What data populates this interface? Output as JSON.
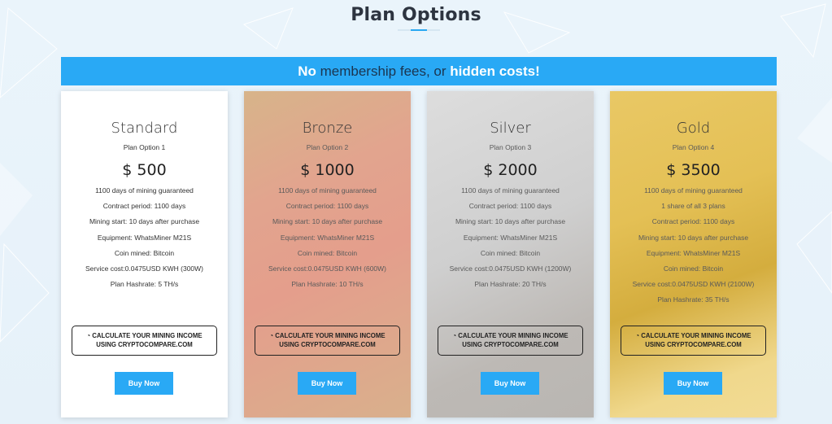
{
  "page": {
    "title": "Plan Options"
  },
  "banner": {
    "part1": "No",
    "part2": " membership fees, or ",
    "part3": "hidden costs!"
  },
  "colors": {
    "accent": "#29a9f5",
    "banner": "#29a9f5",
    "buy_button": "#29a9f5"
  },
  "plans": [
    {
      "name": "Standard",
      "subtitle": "Plan Option 1",
      "price": "$ 500",
      "features": [
        "1100 days of mining guaranteed",
        "Contract period: 1100 days",
        "Mining start: 10 days after purchase",
        "Equipment: WhatsMiner M21S",
        "Coin mined: Bitcoin",
        "Service cost:0.0475USD KWH (300W)",
        "Plan Hashrate: 5 TH/s"
      ],
      "calc_line1": "CALCULATE YOUR MINING INCOME",
      "calc_line2": "USING CRYPTOCOMPARE.COM",
      "buy_label": "Buy Now"
    },
    {
      "name": "Bronze",
      "subtitle": "Plan Option 2",
      "price": "$ 1000",
      "features": [
        "1100 days of mining guaranteed",
        "Contract period: 1100 days",
        "Mining start: 10 days after purchase",
        "Equipment: WhatsMiner M21S",
        "Coin mined: Bitcoin",
        "Service cost:0.0475USD KWH (600W)",
        "Plan Hashrate: 10 TH/s"
      ],
      "calc_line1": "CALCULATE YOUR MINING INCOME",
      "calc_line2": "USING CRYPTOCOMPARE.COM",
      "buy_label": "Buy Now"
    },
    {
      "name": "Silver",
      "subtitle": "Plan Option 3",
      "price": "$ 2000",
      "features": [
        "1100 days of mining guaranteed",
        "Contract period: 1100 days",
        "Mining start: 10 days after purchase",
        "Equipment: WhatsMiner M21S",
        "Coin mined: Bitcoin",
        "Service cost:0.0475USD KWH (1200W)",
        "Plan Hashrate: 20 TH/s"
      ],
      "calc_line1": "CALCULATE YOUR MINING INCOME",
      "calc_line2": "USING CRYPTOCOMPARE.COM",
      "buy_label": "Buy Now"
    },
    {
      "name": "Gold",
      "subtitle": "Plan Option 4",
      "price": "$ 3500",
      "features": [
        "1100 days of mining guaranteed",
        "1 share of all 3 plans",
        "Contract period: 1100 days",
        "Mining start: 10 days after purchase",
        "Equipment: WhatsMiner M21S",
        "Coin mined: Bitcoin",
        "Service cost:0.0475USD KWH (2100W)",
        "Plan Hashrate: 35 TH/s"
      ],
      "calc_line1": "CALCULATE YOUR MINING INCOME",
      "calc_line2": "USING CRYPTOCOMPARE.COM",
      "buy_label": "Buy Now"
    }
  ],
  "icons": {
    "calc": "gauge-icon"
  }
}
